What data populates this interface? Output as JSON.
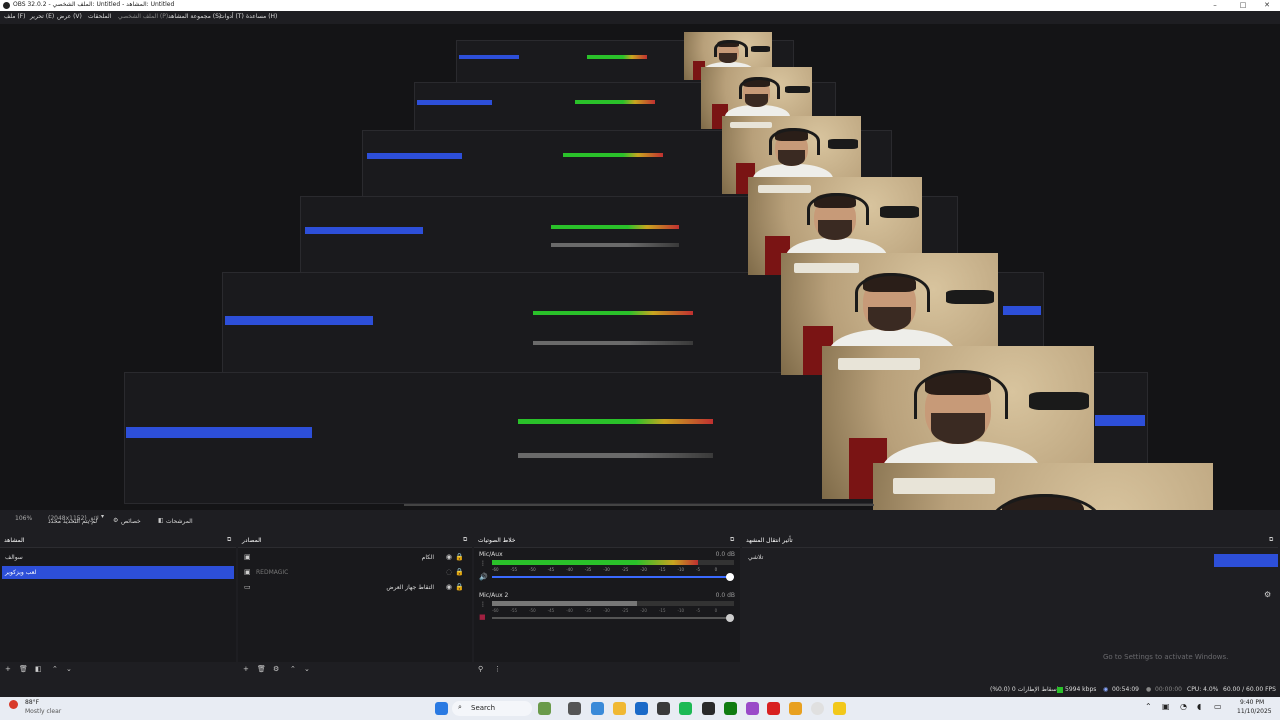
{
  "window": {
    "title": "OBS 32.0.2 - الملف الشخصي: Untitled - المشاهد: Untitled"
  },
  "menu": {
    "items": [
      "ملف (F)",
      "تحرير (E)",
      "عرض (V)",
      "الملحقات",
      "الملف الشخصي (P)",
      "مجموعة المشاهد (S)",
      "أدوات (T)",
      "مساعدة (H)"
    ]
  },
  "preview": {
    "zoom": "106%",
    "resolution": "(2048x1152) لائق"
  },
  "toolbar": {
    "studio_mode": "لم يتم التحديد محدد",
    "properties": "خصائص",
    "filters": "المرشحات"
  },
  "scenes": {
    "title": "المشاهد",
    "items": [
      "سوالف",
      "لعب ويزكوير"
    ],
    "active_index": 1
  },
  "sources": {
    "title": "المصادر",
    "items": [
      {
        "icon": "camera-icon",
        "label": "الكام"
      },
      {
        "icon": "camera-icon",
        "label": "REDMAGIC"
      },
      {
        "icon": "monitor-icon",
        "label": "التقاط جهاز العرض"
      }
    ]
  },
  "mixer": {
    "title": "خلاط الصوتيات",
    "channels": [
      {
        "name": "Mic/Aux",
        "db": "0.0 dB",
        "level": 0.85
      },
      {
        "name": "Mic/Aux 2",
        "db": "0.0 dB",
        "level": 0.6
      }
    ],
    "ticks": [
      "-60",
      "-55",
      "-50",
      "-45",
      "-40",
      "-35",
      "-30",
      "-25",
      "-20",
      "-15",
      "-10",
      "-5",
      "0"
    ]
  },
  "transitions": {
    "title": "تأثير انتقال المشهد",
    "type": "تلاشي"
  },
  "status": {
    "dropped": "إسقاط الإطارات 0 (0.0%)",
    "bitrate": "5994 kbps",
    "stream_time": "00:54:09",
    "rec_time": "00:00:00",
    "cpu": "CPU: 4.0%",
    "fps": "60.00 / 60.00 FPS"
  },
  "watermark": "Go to Settings to activate Windows.",
  "taskbar": {
    "weather_temp": "88°F",
    "weather_desc": "Mostly clear",
    "search": "Search",
    "time": "9:40 PM",
    "date": "11/10/2025"
  },
  "colors": {
    "accent": "#2d4fd9",
    "meter_green": "#2ac12a",
    "meter_yellow": "#c8a520",
    "meter_red": "#c03030"
  }
}
